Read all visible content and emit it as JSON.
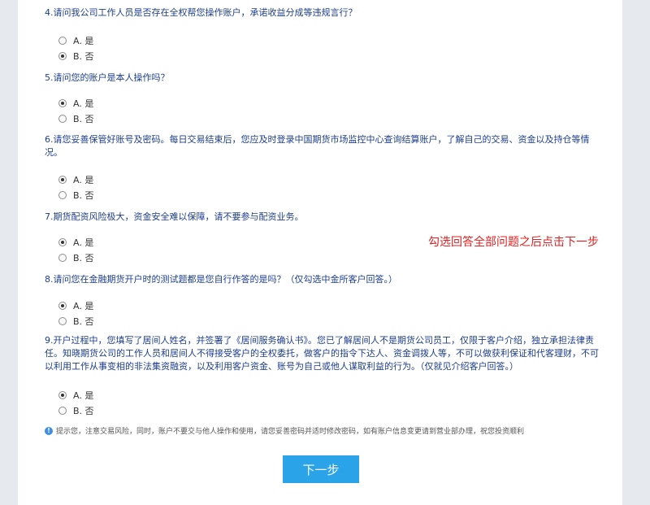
{
  "questions": [
    {
      "text": "4.请问我公司工作人员是否存在全权帮您操作账户，承诺收益分成等违规言行？",
      "options": [
        {
          "label": "A. 是",
          "checked": false
        },
        {
          "label": "B. 否",
          "checked": true
        }
      ]
    },
    {
      "text": "5.请问您的账户是本人操作吗？",
      "options": [
        {
          "label": "A. 是",
          "checked": true
        },
        {
          "label": "B. 否",
          "checked": false
        }
      ]
    },
    {
      "text": "6.请您妥善保管好账号及密码。每日交易结束后，您应及时登录中国期货市场监控中心查询结算账户，了解自己的交易、资金以及持仓等情况。",
      "options": [
        {
          "label": "A. 是",
          "checked": true
        },
        {
          "label": "B. 否",
          "checked": false
        }
      ]
    },
    {
      "text": "7.期货配资风险极大，资金安全难以保障，请不要参与配资业务。",
      "options": [
        {
          "label": "A. 是",
          "checked": true
        },
        {
          "label": "B. 否",
          "checked": false
        }
      ]
    },
    {
      "text": "8.请问您在金融期货开户时的测试题都是您自行作答的是吗？（仅勾选中金所客户回答。）",
      "options": [
        {
          "label": "A. 是",
          "checked": true
        },
        {
          "label": "B. 否",
          "checked": false
        }
      ]
    },
    {
      "text": "9.开户过程中，您填写了居间人姓名，并签署了《居间服务确认书》。您已了解居间人不是期货公司员工，仅限于客户介绍，独立承担法律责任。知晓期货公司的工作人员和居间人不得接受客户的全权委托，做客户的指令下达人、资金调拨人等，不可以做获利保证和代客理财，不可以利用工作从事变相的非法集资融资，以及利用客户资金、账号为自己或他人谋取利益的行为。（仅就见介绍客户回答。）",
      "options": [
        {
          "label": "A. 是",
          "checked": true
        },
        {
          "label": "B. 否",
          "checked": false
        }
      ]
    }
  ],
  "hint": {
    "icon": "info-icon",
    "text": "提示您，注意交易风险，同时，账户不要交与他人操作和使用，请您妥善密码并适时修改密码，如有账户信息变更请到营业部办理，祝您投资顺利"
  },
  "next_button": "下一步",
  "annotation": "勾选回答全部问题之后点击下一步"
}
